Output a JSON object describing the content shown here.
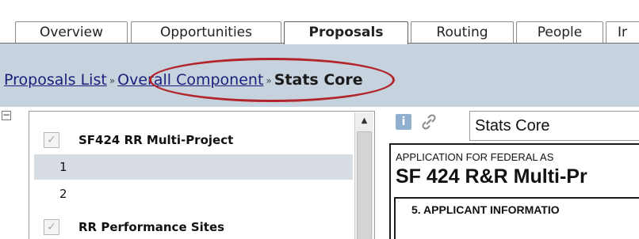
{
  "tabs": [
    {
      "label": "Overview",
      "active": false
    },
    {
      "label": "Opportunities",
      "active": false
    },
    {
      "label": "Proposals",
      "active": true
    },
    {
      "label": "Routing",
      "active": false
    },
    {
      "label": "People",
      "active": false
    },
    {
      "label": "Ir",
      "active": false
    }
  ],
  "breadcrumb": {
    "items": [
      "Proposals List",
      "Overall Component"
    ],
    "separator": "»",
    "current": "Stats Core"
  },
  "tree": {
    "collapse_symbol": "−",
    "items": [
      {
        "label": "SF424 RR Multi-Project",
        "type": "group",
        "checked": true
      },
      {
        "label": "1",
        "type": "item",
        "selected": true
      },
      {
        "label": "2",
        "type": "item",
        "selected": false
      },
      {
        "label": "RR Performance Sites",
        "type": "group",
        "checked": true
      }
    ]
  },
  "detail": {
    "title_value": "Stats Core",
    "form": {
      "header_label": "APPLICATION FOR FEDERAL AS",
      "title": "SF 424 R&R Multi-Pr",
      "section_label": "5. APPLICANT INFORMATIO"
    }
  },
  "icons": {
    "info": "info-icon",
    "link": "link-icon",
    "checkbox": "checkbox-icon",
    "scroll_up": "scroll-up-arrow-icon"
  },
  "colors": {
    "breadcrumb_band": "#c6d3df",
    "highlight_oval": "#b2252b",
    "selected_row": "#d8dde4",
    "link": "#1b1f7a"
  }
}
